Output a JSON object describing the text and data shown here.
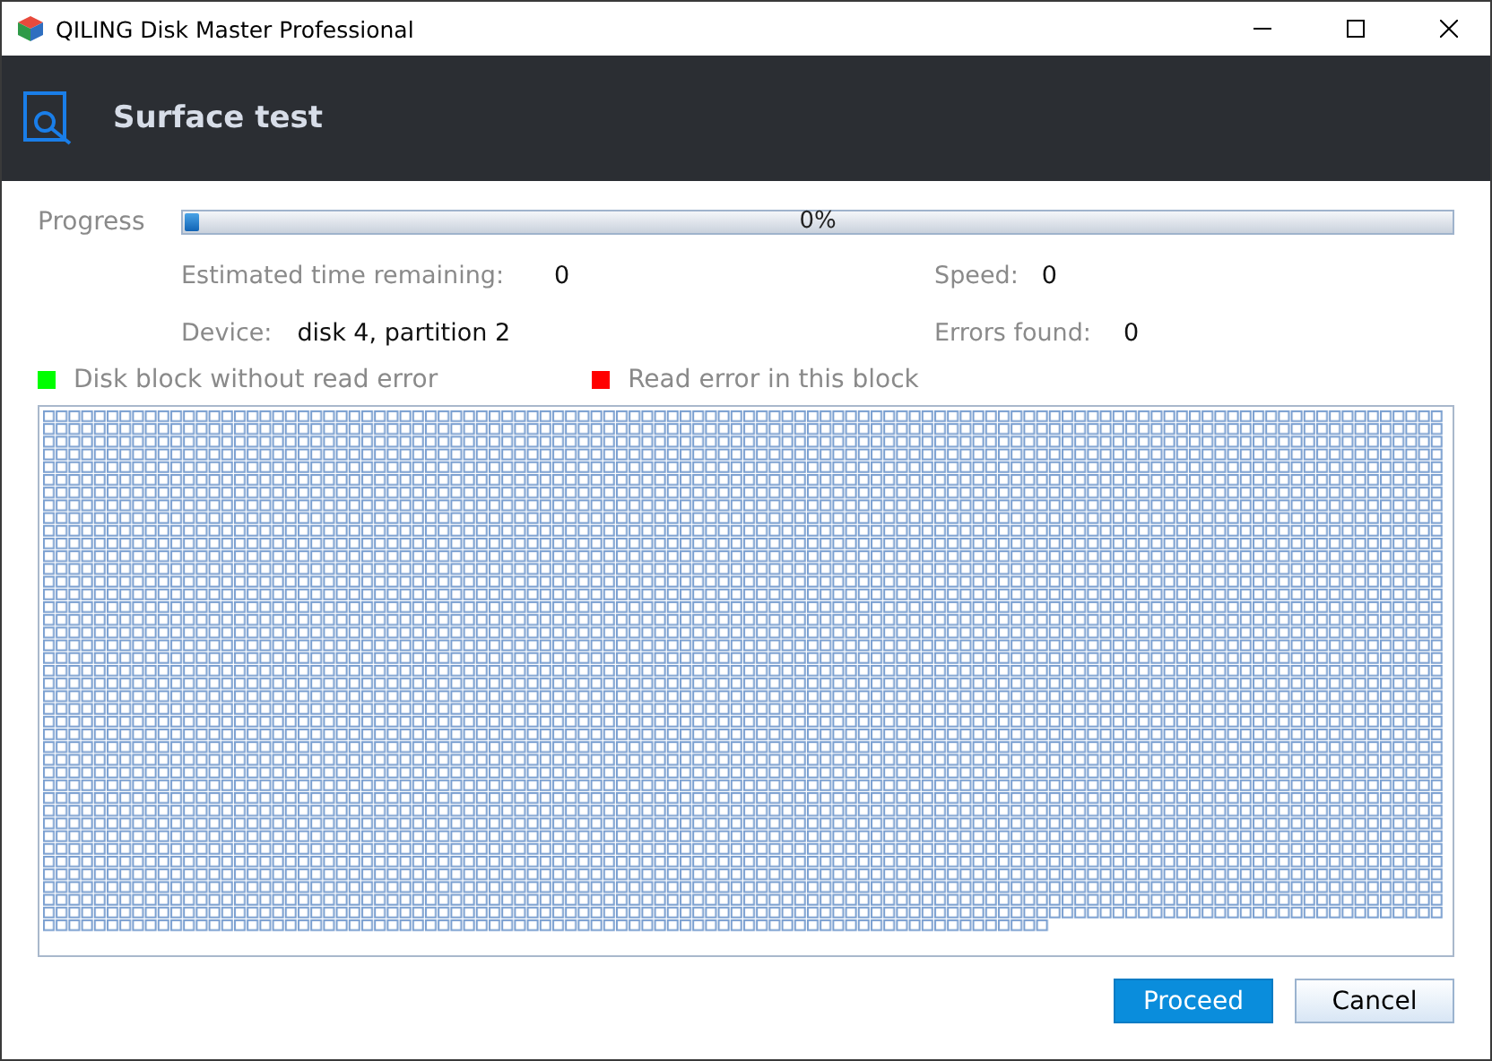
{
  "window": {
    "title": "QILING Disk Master Professional"
  },
  "header": {
    "title": "Surface test"
  },
  "progress": {
    "label": "Progress",
    "level": 0.005,
    "reading": "0%"
  },
  "stats": [
    {
      "label": "Estimated time remaining:",
      "value": "0"
    },
    {
      "label": "Speed:",
      "value": "0"
    },
    {
      "label": "Device:",
      "value": "disk 4, partition 2"
    },
    {
      "label": "Errors found:",
      "value": "0"
    }
  ],
  "legend": [
    {
      "label": "Disk block without read error",
      "color": "#00ff00"
    },
    {
      "label": "Read error in this block",
      "color": "#ff0000"
    }
  ],
  "buttons": [
    {
      "label": "Proceed",
      "kind": "primary"
    },
    {
      "label": "Cancel",
      "kind": "secondary"
    }
  ]
}
